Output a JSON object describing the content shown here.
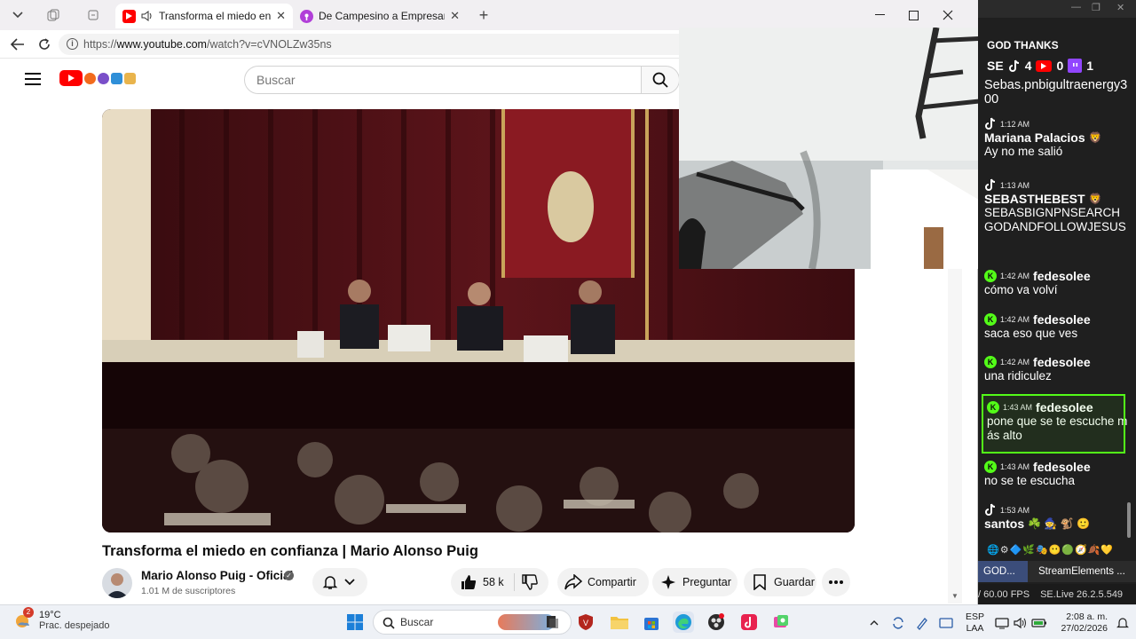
{
  "browser": {
    "tabs": [
      {
        "title": "Transforma el miedo en confianza",
        "audio": true,
        "active": true
      },
      {
        "title": "De Campesino a Empresario- cómo",
        "active": false
      }
    ],
    "new_tab_label": "+",
    "address": {
      "prefix": "https://",
      "host": "www.youtube.com",
      "path": "/watch?v=cVNOLZw35ns"
    },
    "window_controls": [
      "minimize",
      "maximize",
      "close"
    ]
  },
  "youtube": {
    "search_placeholder": "Buscar",
    "video": {
      "title": "Transforma el miedo en confianza | Mario Alonso Puig",
      "channel": "Mario Alonso Puig - Oficial",
      "subscribers": "1.01 M de suscriptores",
      "likes": "58 k",
      "actions": {
        "share": "Compartir",
        "ask": "Preguntar",
        "save": "Guardar"
      }
    }
  },
  "chat": {
    "header": "GOD THANKS",
    "top_line": "SE",
    "top_counts": [
      "4",
      "0",
      "1"
    ],
    "messages": [
      {
        "source": "tiktok",
        "time": "",
        "user": "",
        "text": "Sebas.pnbigultraenergy300"
      },
      {
        "source": "tiktok",
        "time": "1:12 AM",
        "user": "Mariana Palacios",
        "text": "Ay no me salió"
      },
      {
        "source": "tiktok",
        "time": "1:13 AM",
        "user": "SEBASTHEBEST",
        "text": "SEBASBIGNPNSEARCHGODANDFOLLOWJESUS"
      },
      {
        "source": "kick",
        "time": "1:42 AM",
        "user": "fedesolee",
        "text": "cómo va volví"
      },
      {
        "source": "kick",
        "time": "1:42 AM",
        "user": "fedesolee",
        "text": "saca eso que ves"
      },
      {
        "source": "kick",
        "time": "1:42 AM",
        "user": "fedesolee",
        "text": "una ridiculez"
      },
      {
        "source": "kick",
        "time": "1:43 AM",
        "user": "fedesolee",
        "text": "pone que se te escuche más alto"
      },
      {
        "source": "kick",
        "time": "1:43 AM",
        "user": "fedesolee",
        "text": "no se te escucha"
      },
      {
        "source": "tiktok",
        "time": "1:53 AM",
        "user": "santos",
        "text": ""
      }
    ],
    "tabs": [
      "GOD...",
      "StreamElements ..."
    ],
    "status": {
      "fps": "/ 60.00 FPS",
      "version": "SE.Live 26.2.5.549"
    }
  },
  "taskbar": {
    "weather": {
      "temp": "19°C",
      "condition": "Prac. despejado",
      "badge": "2"
    },
    "search_label": "Buscar",
    "lang": {
      "top": "ESP",
      "bottom": "LAA"
    },
    "clock": {
      "time": "2:08 a. m.",
      "date": "27/02/2026"
    }
  },
  "colors": {
    "youtube_red": "#ff0000",
    "kick_green": "#53fc18",
    "twitch_purple": "#9146ff",
    "taskbar": "#eef1f6"
  }
}
